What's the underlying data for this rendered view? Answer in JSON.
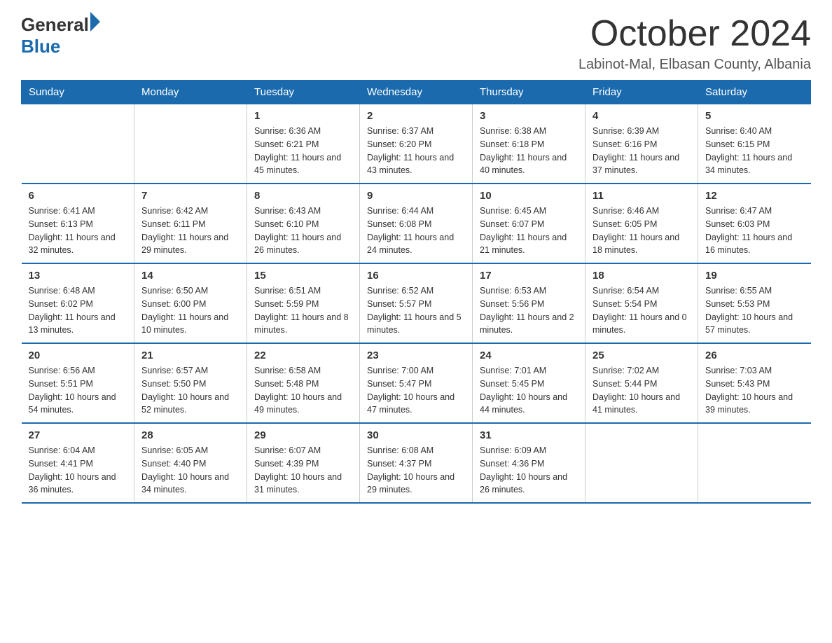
{
  "logo": {
    "general": "General",
    "blue": "Blue"
  },
  "title": "October 2024",
  "location": "Labinot-Mal, Elbasan County, Albania",
  "days_of_week": [
    "Sunday",
    "Monday",
    "Tuesday",
    "Wednesday",
    "Thursday",
    "Friday",
    "Saturday"
  ],
  "weeks": [
    [
      {
        "day": "",
        "sunrise": "",
        "sunset": "",
        "daylight": ""
      },
      {
        "day": "",
        "sunrise": "",
        "sunset": "",
        "daylight": ""
      },
      {
        "day": "1",
        "sunrise": "Sunrise: 6:36 AM",
        "sunset": "Sunset: 6:21 PM",
        "daylight": "Daylight: 11 hours and 45 minutes."
      },
      {
        "day": "2",
        "sunrise": "Sunrise: 6:37 AM",
        "sunset": "Sunset: 6:20 PM",
        "daylight": "Daylight: 11 hours and 43 minutes."
      },
      {
        "day": "3",
        "sunrise": "Sunrise: 6:38 AM",
        "sunset": "Sunset: 6:18 PM",
        "daylight": "Daylight: 11 hours and 40 minutes."
      },
      {
        "day": "4",
        "sunrise": "Sunrise: 6:39 AM",
        "sunset": "Sunset: 6:16 PM",
        "daylight": "Daylight: 11 hours and 37 minutes."
      },
      {
        "day": "5",
        "sunrise": "Sunrise: 6:40 AM",
        "sunset": "Sunset: 6:15 PM",
        "daylight": "Daylight: 11 hours and 34 minutes."
      }
    ],
    [
      {
        "day": "6",
        "sunrise": "Sunrise: 6:41 AM",
        "sunset": "Sunset: 6:13 PM",
        "daylight": "Daylight: 11 hours and 32 minutes."
      },
      {
        "day": "7",
        "sunrise": "Sunrise: 6:42 AM",
        "sunset": "Sunset: 6:11 PM",
        "daylight": "Daylight: 11 hours and 29 minutes."
      },
      {
        "day": "8",
        "sunrise": "Sunrise: 6:43 AM",
        "sunset": "Sunset: 6:10 PM",
        "daylight": "Daylight: 11 hours and 26 minutes."
      },
      {
        "day": "9",
        "sunrise": "Sunrise: 6:44 AM",
        "sunset": "Sunset: 6:08 PM",
        "daylight": "Daylight: 11 hours and 24 minutes."
      },
      {
        "day": "10",
        "sunrise": "Sunrise: 6:45 AM",
        "sunset": "Sunset: 6:07 PM",
        "daylight": "Daylight: 11 hours and 21 minutes."
      },
      {
        "day": "11",
        "sunrise": "Sunrise: 6:46 AM",
        "sunset": "Sunset: 6:05 PM",
        "daylight": "Daylight: 11 hours and 18 minutes."
      },
      {
        "day": "12",
        "sunrise": "Sunrise: 6:47 AM",
        "sunset": "Sunset: 6:03 PM",
        "daylight": "Daylight: 11 hours and 16 minutes."
      }
    ],
    [
      {
        "day": "13",
        "sunrise": "Sunrise: 6:48 AM",
        "sunset": "Sunset: 6:02 PM",
        "daylight": "Daylight: 11 hours and 13 minutes."
      },
      {
        "day": "14",
        "sunrise": "Sunrise: 6:50 AM",
        "sunset": "Sunset: 6:00 PM",
        "daylight": "Daylight: 11 hours and 10 minutes."
      },
      {
        "day": "15",
        "sunrise": "Sunrise: 6:51 AM",
        "sunset": "Sunset: 5:59 PM",
        "daylight": "Daylight: 11 hours and 8 minutes."
      },
      {
        "day": "16",
        "sunrise": "Sunrise: 6:52 AM",
        "sunset": "Sunset: 5:57 PM",
        "daylight": "Daylight: 11 hours and 5 minutes."
      },
      {
        "day": "17",
        "sunrise": "Sunrise: 6:53 AM",
        "sunset": "Sunset: 5:56 PM",
        "daylight": "Daylight: 11 hours and 2 minutes."
      },
      {
        "day": "18",
        "sunrise": "Sunrise: 6:54 AM",
        "sunset": "Sunset: 5:54 PM",
        "daylight": "Daylight: 11 hours and 0 minutes."
      },
      {
        "day": "19",
        "sunrise": "Sunrise: 6:55 AM",
        "sunset": "Sunset: 5:53 PM",
        "daylight": "Daylight: 10 hours and 57 minutes."
      }
    ],
    [
      {
        "day": "20",
        "sunrise": "Sunrise: 6:56 AM",
        "sunset": "Sunset: 5:51 PM",
        "daylight": "Daylight: 10 hours and 54 minutes."
      },
      {
        "day": "21",
        "sunrise": "Sunrise: 6:57 AM",
        "sunset": "Sunset: 5:50 PM",
        "daylight": "Daylight: 10 hours and 52 minutes."
      },
      {
        "day": "22",
        "sunrise": "Sunrise: 6:58 AM",
        "sunset": "Sunset: 5:48 PM",
        "daylight": "Daylight: 10 hours and 49 minutes."
      },
      {
        "day": "23",
        "sunrise": "Sunrise: 7:00 AM",
        "sunset": "Sunset: 5:47 PM",
        "daylight": "Daylight: 10 hours and 47 minutes."
      },
      {
        "day": "24",
        "sunrise": "Sunrise: 7:01 AM",
        "sunset": "Sunset: 5:45 PM",
        "daylight": "Daylight: 10 hours and 44 minutes."
      },
      {
        "day": "25",
        "sunrise": "Sunrise: 7:02 AM",
        "sunset": "Sunset: 5:44 PM",
        "daylight": "Daylight: 10 hours and 41 minutes."
      },
      {
        "day": "26",
        "sunrise": "Sunrise: 7:03 AM",
        "sunset": "Sunset: 5:43 PM",
        "daylight": "Daylight: 10 hours and 39 minutes."
      }
    ],
    [
      {
        "day": "27",
        "sunrise": "Sunrise: 6:04 AM",
        "sunset": "Sunset: 4:41 PM",
        "daylight": "Daylight: 10 hours and 36 minutes."
      },
      {
        "day": "28",
        "sunrise": "Sunrise: 6:05 AM",
        "sunset": "Sunset: 4:40 PM",
        "daylight": "Daylight: 10 hours and 34 minutes."
      },
      {
        "day": "29",
        "sunrise": "Sunrise: 6:07 AM",
        "sunset": "Sunset: 4:39 PM",
        "daylight": "Daylight: 10 hours and 31 minutes."
      },
      {
        "day": "30",
        "sunrise": "Sunrise: 6:08 AM",
        "sunset": "Sunset: 4:37 PM",
        "daylight": "Daylight: 10 hours and 29 minutes."
      },
      {
        "day": "31",
        "sunrise": "Sunrise: 6:09 AM",
        "sunset": "Sunset: 4:36 PM",
        "daylight": "Daylight: 10 hours and 26 minutes."
      },
      {
        "day": "",
        "sunrise": "",
        "sunset": "",
        "daylight": ""
      },
      {
        "day": "",
        "sunrise": "",
        "sunset": "",
        "daylight": ""
      }
    ]
  ]
}
